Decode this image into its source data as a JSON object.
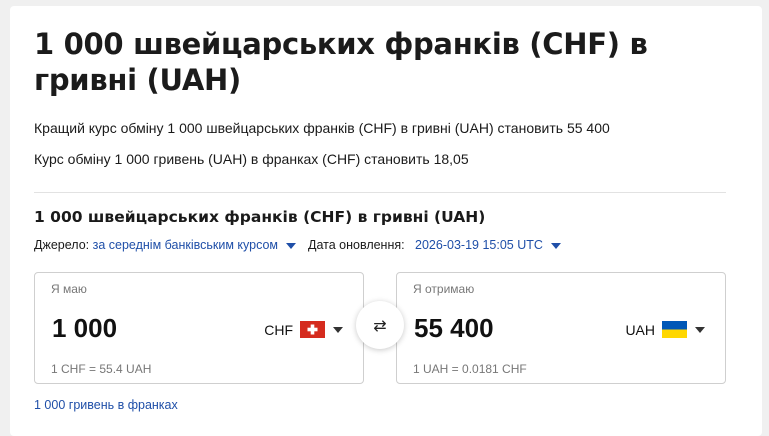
{
  "page": {
    "title": "1 000 швейцарських франків (CHF) в гривні (UAH)",
    "best_rate_text": "Кращий курс обміну 1 000 швейцарських франків (CHF) в гривні (UAH) становить 55 400",
    "reverse_rate_text": "Курс обміну 1 000 гривень (UAH) в франках (CHF) становить 18,05"
  },
  "converter": {
    "title": "1 000 швейцарських франків (CHF) в гривні (UAH)",
    "source_label": "Джерело:",
    "source_value": "за середнім банківським курсом",
    "date_label": "Дата оновлення:",
    "date_value": "2026-03-19 15:05 UTC",
    "have": {
      "label": "Я маю",
      "amount": "1 000",
      "currency": "CHF",
      "flag_icon": "switzerland-flag-icon",
      "unit_rate": "1 CHF = 55.4 UAH"
    },
    "get": {
      "label": "Я отримаю",
      "amount": "55 400",
      "currency": "UAH",
      "flag_icon": "ukraine-flag-icon",
      "unit_rate": "1 UAH = 0.0181 CHF"
    },
    "swap_glyph": "⇄",
    "reverse_link": "1 000 гривень в франках"
  },
  "colors": {
    "link": "#1f4fa8",
    "swiss_red": "#d52b1e",
    "ukraine_blue": "#0057b7",
    "ukraine_yellow": "#ffd700"
  }
}
